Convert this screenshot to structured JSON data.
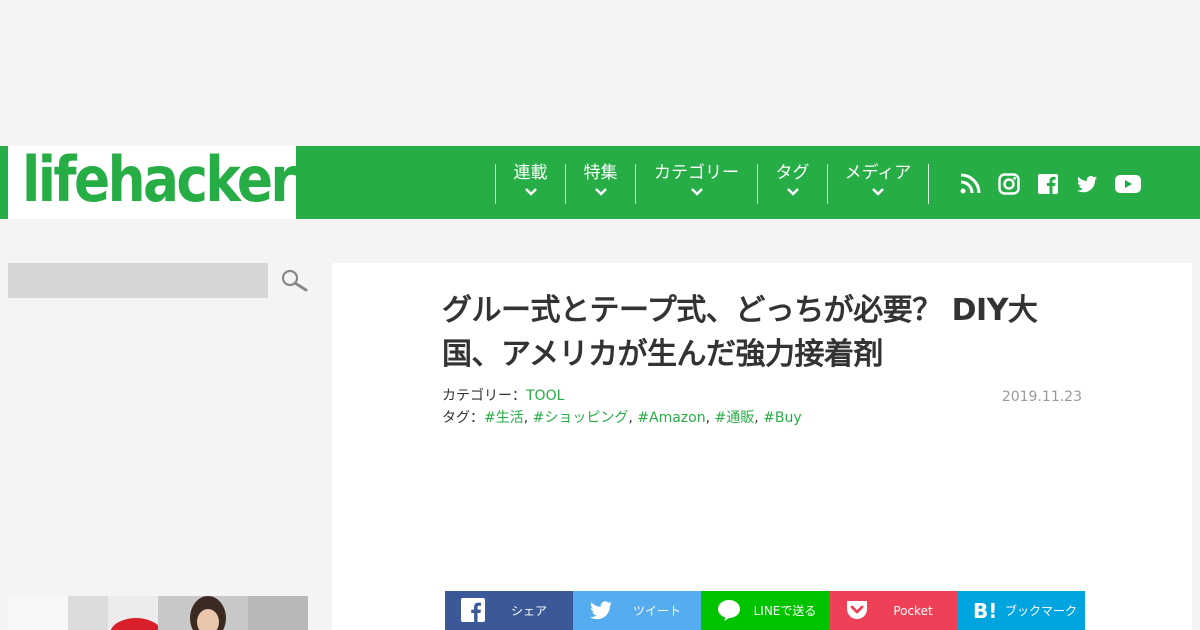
{
  "logo": {
    "text": "lifehacker"
  },
  "nav": {
    "items": [
      {
        "label": "連載"
      },
      {
        "label": "特集"
      },
      {
        "label": "カテゴリー"
      },
      {
        "label": "タグ"
      },
      {
        "label": "メディア"
      }
    ],
    "social_icons": [
      "rss-icon",
      "instagram-icon",
      "facebook-icon",
      "twitter-icon",
      "youtube-icon"
    ]
  },
  "search": {
    "placeholder": "",
    "button_icon": "search-icon"
  },
  "article": {
    "title": "グルー式とテープ式、どっちが必要？ DIY大国、アメリカが生んだ強力接着剤",
    "category_label": "カテゴリー：",
    "category": "TOOL",
    "tags_label": "タグ：",
    "tags": [
      "#生活",
      "#ショッピング",
      "#Amazon",
      "#通販",
      "#Buy"
    ],
    "date": "2019.11.23"
  },
  "share": [
    {
      "label": "シェア",
      "icon": "facebook-icon",
      "color": "#3b5998"
    },
    {
      "label": "ツイート",
      "icon": "twitter-icon",
      "color": "#55acee"
    },
    {
      "label": "LINEで送る",
      "icon": "line-icon",
      "color": "#00c300"
    },
    {
      "label": "Pocket",
      "icon": "pocket-icon",
      "color": "#ee4056"
    },
    {
      "label": "ブックマーク",
      "icon": "hatena-bookmark-icon",
      "color": "#00a4de"
    }
  ],
  "colors": {
    "brand": "#27ad46",
    "page_bg": "#f4f4f4"
  }
}
